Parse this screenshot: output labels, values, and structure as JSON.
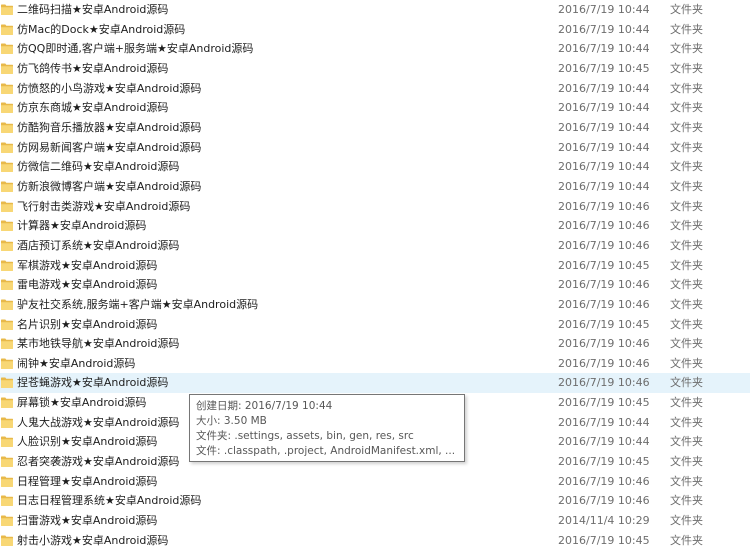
{
  "file_list": {
    "rows": [
      {
        "name": "二维码扫描★安卓Android源码",
        "date": "2016/7/19 10:44",
        "type": "文件夹"
      },
      {
        "name": "仿Mac的Dock★安卓Android源码",
        "date": "2016/7/19 10:44",
        "type": "文件夹"
      },
      {
        "name": "仿QQ即时通,客户端+服务端★安卓Android源码",
        "date": "2016/7/19 10:44",
        "type": "文件夹"
      },
      {
        "name": "仿飞鸽传书★安卓Android源码",
        "date": "2016/7/19 10:45",
        "type": "文件夹"
      },
      {
        "name": "仿愤怒的小鸟游戏★安卓Android源码",
        "date": "2016/7/19 10:44",
        "type": "文件夹"
      },
      {
        "name": "仿京东商城★安卓Android源码",
        "date": "2016/7/19 10:44",
        "type": "文件夹"
      },
      {
        "name": "仿酷狗音乐播放器★安卓Android源码",
        "date": "2016/7/19 10:44",
        "type": "文件夹"
      },
      {
        "name": "仿网易新闻客户端★安卓Android源码",
        "date": "2016/7/19 10:44",
        "type": "文件夹"
      },
      {
        "name": "仿微信二维码★安卓Android源码",
        "date": "2016/7/19 10:44",
        "type": "文件夹"
      },
      {
        "name": "仿新浪微博客户端★安卓Android源码",
        "date": "2016/7/19 10:44",
        "type": "文件夹"
      },
      {
        "name": "飞行射击类游戏★安卓Android源码",
        "date": "2016/7/19 10:46",
        "type": "文件夹"
      },
      {
        "name": "计算器★安卓Android源码",
        "date": "2016/7/19 10:46",
        "type": "文件夹"
      },
      {
        "name": "酒店预订系统★安卓Android源码",
        "date": "2016/7/19 10:46",
        "type": "文件夹"
      },
      {
        "name": "军棋游戏★安卓Android源码",
        "date": "2016/7/19 10:45",
        "type": "文件夹"
      },
      {
        "name": "雷电游戏★安卓Android源码",
        "date": "2016/7/19 10:46",
        "type": "文件夹"
      },
      {
        "name": "驴友社交系统,服务端+客户端★安卓Android源码",
        "date": "2016/7/19 10:46",
        "type": "文件夹"
      },
      {
        "name": "名片识别★安卓Android源码",
        "date": "2016/7/19 10:45",
        "type": "文件夹"
      },
      {
        "name": "某市地铁导航★安卓Android源码",
        "date": "2016/7/19 10:46",
        "type": "文件夹"
      },
      {
        "name": "闹钟★安卓Android源码",
        "date": "2016/7/19 10:46",
        "type": "文件夹"
      },
      {
        "name": "捏苍蝇游戏★安卓Android源码",
        "date": "2016/7/19 10:46",
        "type": "文件夹"
      },
      {
        "name": "屏幕锁★安卓Android源码",
        "date": "2016/7/19 10:45",
        "type": "文件夹"
      },
      {
        "name": "人鬼大战游戏★安卓Android源码",
        "date": "2016/7/19 10:44",
        "type": "文件夹"
      },
      {
        "name": "人脸识别★安卓Android源码",
        "date": "2016/7/19 10:44",
        "type": "文件夹"
      },
      {
        "name": "忍者突袭游戏★安卓Android源码",
        "date": "2016/7/19 10:45",
        "type": "文件夹"
      },
      {
        "name": "日程管理★安卓Android源码",
        "date": "2016/7/19 10:46",
        "type": "文件夹"
      },
      {
        "name": "日志日程管理系统★安卓Android源码",
        "date": "2016/7/19 10:46",
        "type": "文件夹"
      },
      {
        "name": "扫雷游戏★安卓Android源码",
        "date": "2014/11/4 10:29",
        "type": "文件夹"
      },
      {
        "name": "射击小游戏★安卓Android源码",
        "date": "2016/7/19 10:45",
        "type": "文件夹"
      }
    ],
    "selected_index": 19
  },
  "tooltip": {
    "created": "创建日期: 2016/7/19 10:44",
    "size": "大小: 3.50 MB",
    "folders": "文件夹: .settings, assets, bin, gen, res, src",
    "files": "文件: .classpath, .project, AndroidManifest.xml, ..."
  },
  "colors": {
    "folder_body": "#f8d775",
    "folder_back": "#e8b94a",
    "selected_row": "#e5f3fb",
    "meta_text": "#6d6d6d"
  },
  "icons": {
    "row_icon": "folder-icon"
  }
}
